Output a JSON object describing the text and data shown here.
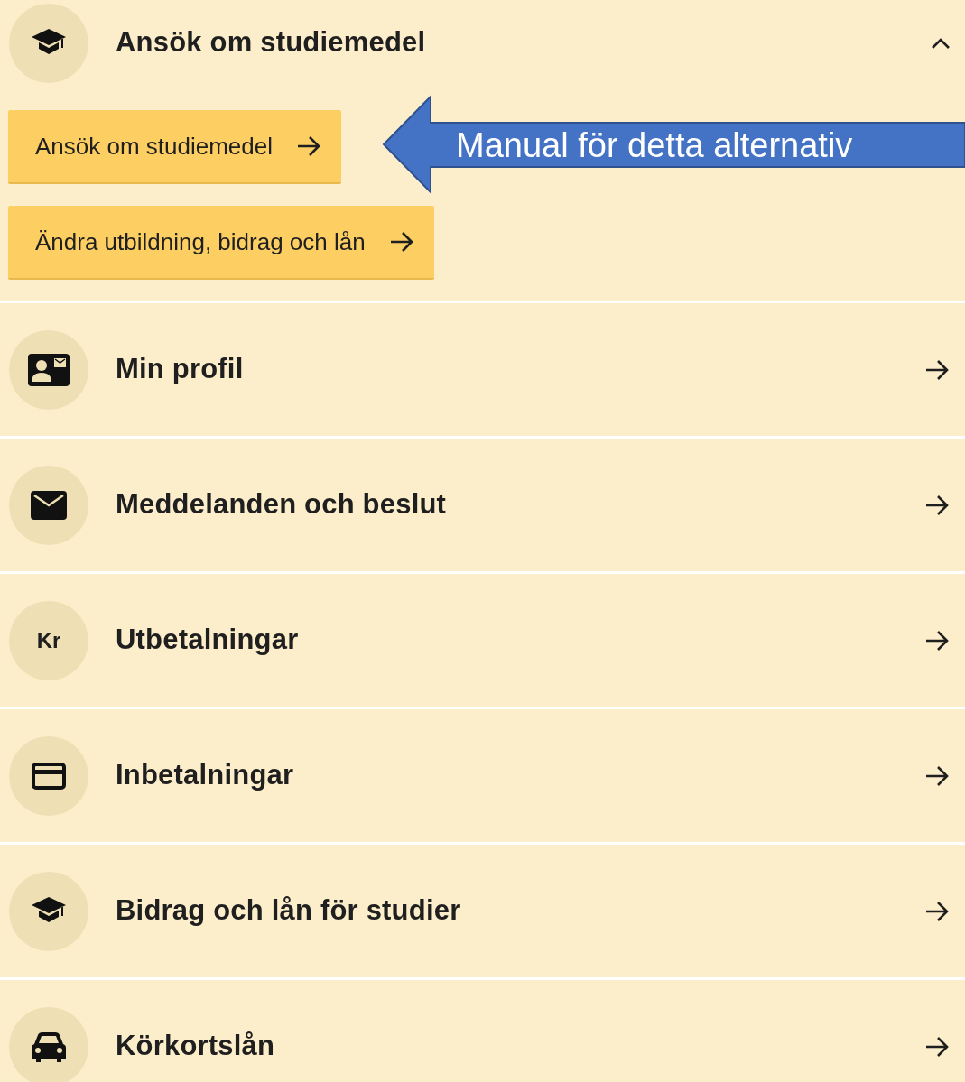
{
  "menu": [
    {
      "kind": "accordion",
      "label": "Ansök om studiemedel",
      "expanded": true,
      "actions": [
        {
          "label": "Ansök om studiemedel"
        },
        {
          "label": "Ändra utbildning, bidrag och lån"
        }
      ]
    },
    {
      "kind": "link",
      "label": "Min profil"
    },
    {
      "kind": "link",
      "label": "Meddelanden och beslut"
    },
    {
      "kind": "link",
      "label": "Utbetalningar",
      "icon_text": "Kr"
    },
    {
      "kind": "link",
      "label": "Inbetalningar"
    },
    {
      "kind": "link",
      "label": "Bidrag och lån för studier"
    },
    {
      "kind": "link",
      "label": "Körkortslån"
    }
  ],
  "callout": {
    "text": "Manual för detta alternativ"
  }
}
